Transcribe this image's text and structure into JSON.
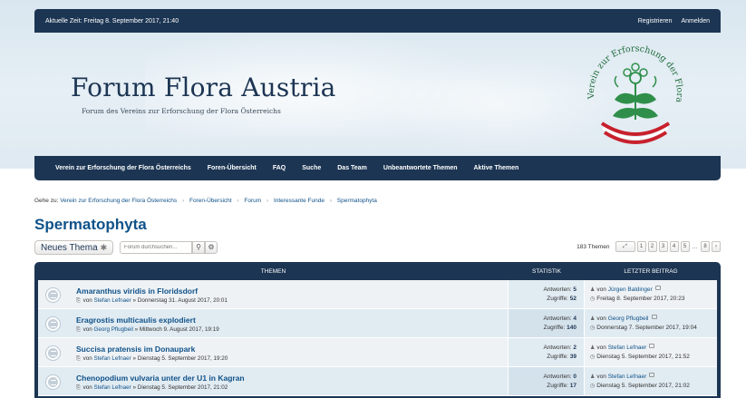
{
  "topbar": {
    "time": "Aktuelle Zeit: Freitag 8. September 2017, 21:40",
    "register": "Registrieren",
    "login": "Anmelden"
  },
  "site": {
    "title": "Forum Flora Austria",
    "description": "Forum des Vereins zur Erforschung der Flora Österreichs",
    "seal_text": "Verein zur Erforschung der Flora Österreichs"
  },
  "nav": [
    "Verein zur Erforschung der Flora Österreichs",
    "Foren-Übersicht",
    "FAQ",
    "Suche",
    "Das Team",
    "Unbeantwortete Themen",
    "Aktive Themen"
  ],
  "breadcrumb": {
    "prefix": "Gehe zu:",
    "items": [
      "Verein zur Erforschung der Flora Österreichs",
      "Foren-Übersicht",
      "Forum",
      "Interessante Funde",
      "Spermatophyta"
    ],
    "separator": "›"
  },
  "page_title": "Spermatophyta",
  "actions": {
    "new_topic": "Neues Thema",
    "search_placeholder": "Forum durchsuchen...",
    "topic_count": "183 Themen",
    "pages": [
      "1",
      "2",
      "3",
      "4",
      "5"
    ],
    "ellipsis": "…",
    "last_page": "8",
    "next": "›"
  },
  "table": {
    "headers": {
      "topics": "THEMEN",
      "stats": "STATISTIK",
      "last_post": "LETZTER BEITRAG"
    },
    "replies_label": "Antworten:",
    "views_label": "Zugriffe:",
    "by_label": "von",
    "rows": [
      {
        "title": "Amaranthus viridis in Floridsdorf",
        "author": "Stefan Lefnaer",
        "date": "» Donnerstag 31. August 2017, 20:01",
        "replies": "5",
        "views": "52",
        "last_author": "Jürgen Baldinger",
        "last_date": "Freitag 8. September 2017, 20:23"
      },
      {
        "title": "Eragrostis multicaulis explodiert",
        "author": "Georg Pflugbeil",
        "date": "» Mittwoch 9. August 2017, 19:19",
        "replies": "4",
        "views": "140",
        "last_author": "Georg Pflugbeil",
        "last_date": "Donnerstag 7. September 2017, 19:04"
      },
      {
        "title": "Succisa pratensis im Donaupark",
        "author": "Stefan Lefnaer",
        "date": "» Dienstag 5. September 2017, 19:20",
        "replies": "2",
        "views": "39",
        "last_author": "Stefan Lefnaer",
        "last_date": "Dienstag 5. September 2017, 21:52"
      },
      {
        "title": "Chenopodium vulvaria unter der U1 in Kagran",
        "author": "Stefan Lefnaer",
        "date": "» Dienstag 5. September 2017, 21:02",
        "replies": "0",
        "views": "17",
        "last_author": "Stefan Lefnaer",
        "last_date": "Dienstag 5. September 2017, 21:02"
      }
    ]
  },
  "colors": {
    "navbar": "#1c3553",
    "link": "#105289",
    "row_light": "#eef2f5",
    "row_dark": "#e1ebf2",
    "seal_green": "#2f8f4a",
    "seal_red": "#c8202c"
  }
}
